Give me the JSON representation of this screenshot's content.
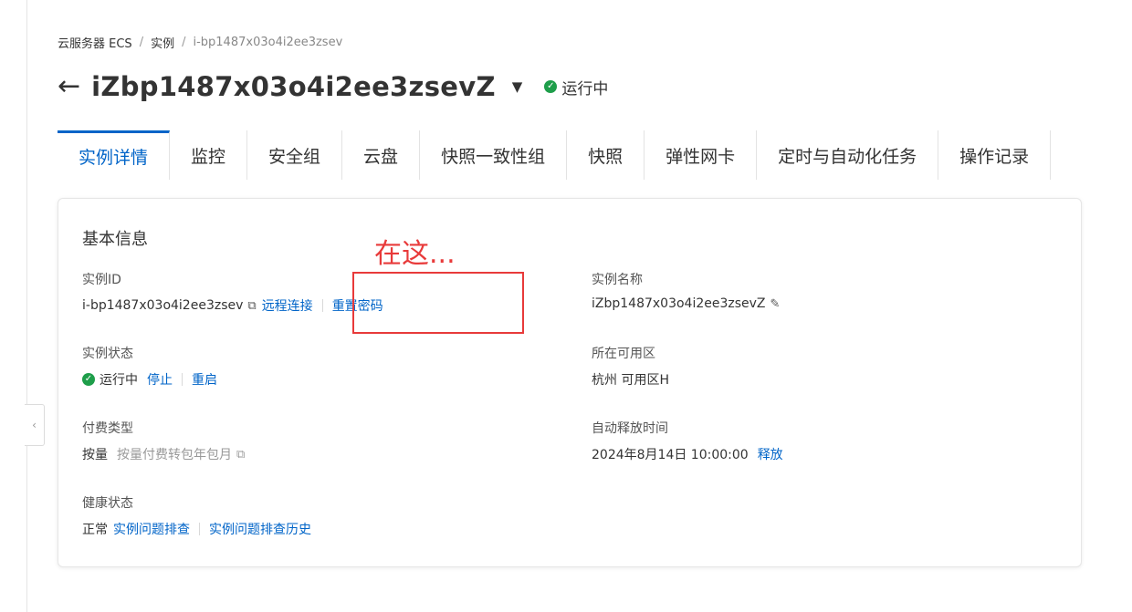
{
  "breadcrumb": {
    "items": [
      "云服务器 ECS",
      "实例",
      "i-bp1487x03o4i2ee3zsev"
    ],
    "separator": "/"
  },
  "header": {
    "back_icon": "←",
    "title": "iZbp1487x03o4i2ee3zsevZ",
    "caret_icon": "▼",
    "status_icon": "✓",
    "status_text": "运行中"
  },
  "tabs": [
    {
      "label": "实例详情",
      "active": true
    },
    {
      "label": "监控"
    },
    {
      "label": "安全组"
    },
    {
      "label": "云盘"
    },
    {
      "label": "快照一致性组"
    },
    {
      "label": "快照"
    },
    {
      "label": "弹性网卡"
    },
    {
      "label": "定时与自动化任务"
    },
    {
      "label": "操作记录"
    }
  ],
  "basic_info": {
    "title": "基本信息",
    "instance_id": {
      "label": "实例ID",
      "value": "i-bp1487x03o4i2ee3zsev",
      "copy_icon": "⧉",
      "remote_connect": "远程连接",
      "reset_password": "重置密码"
    },
    "instance_name": {
      "label": "实例名称",
      "value": "iZbp1487x03o4i2ee3zsevZ",
      "edit_icon": "✎"
    },
    "instance_status": {
      "label": "实例状态",
      "value": "运行中",
      "status_icon": "✓",
      "stop": "停止",
      "restart": "重启"
    },
    "zone": {
      "label": "所在可用区",
      "value": "杭州 可用区H"
    },
    "billing": {
      "label": "付费类型",
      "value": "按量",
      "convert_link": "按量付费转包年包月",
      "external_icon": "⧉"
    },
    "auto_release": {
      "label": "自动释放时间",
      "value": "2024年8月14日 10:00:00",
      "release_link": "释放"
    },
    "health": {
      "label": "健康状态",
      "value": "正常",
      "troubleshoot": "实例问题排查",
      "troubleshoot_history": "实例问题排查历史"
    }
  },
  "annotation": {
    "text": "在这...",
    "color": "#e83a3a"
  },
  "colors": {
    "accent": "#0064c8",
    "success": "#1e9e4a"
  },
  "sidebar_toggle_icon": "‹"
}
